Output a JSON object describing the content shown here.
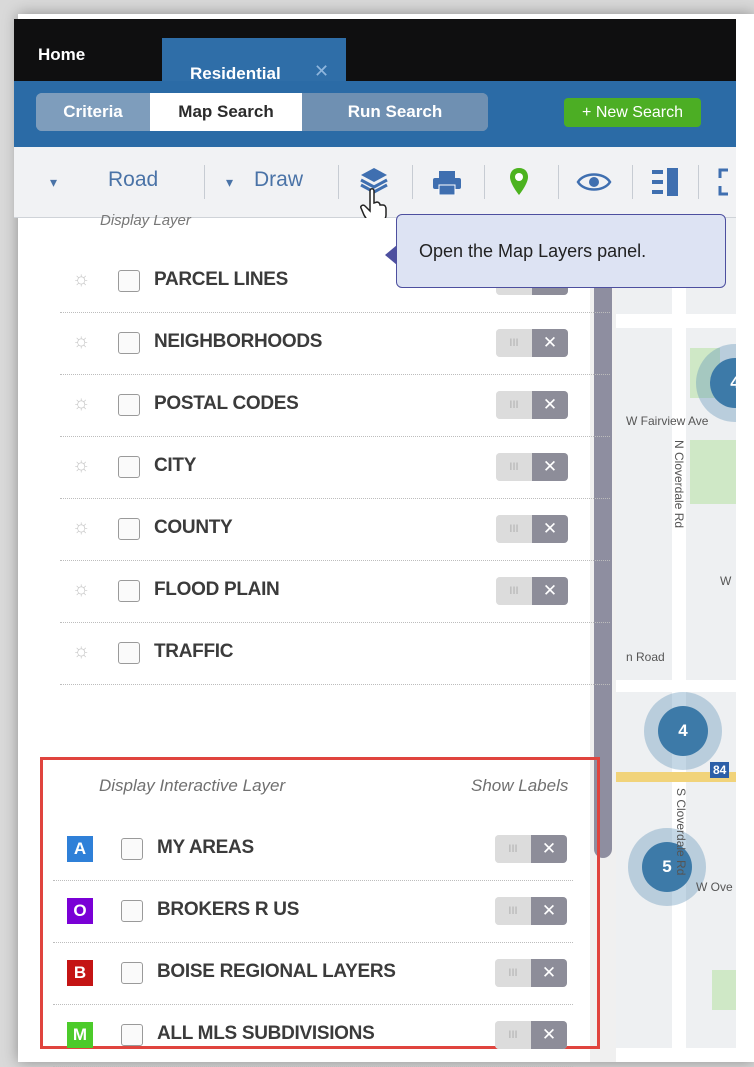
{
  "tabs": {
    "home": "Home",
    "residential": "Residential",
    "close": "✕"
  },
  "subnav": {
    "criteria": "Criteria",
    "map_search": "Map Search",
    "run_search": "Run Search",
    "new_search": "+ New Search"
  },
  "toolbar": {
    "road": "Road",
    "draw": "Draw"
  },
  "tooltip": "Open the Map Layers panel.",
  "panel": {
    "display_layer_header": "Display Layer",
    "layers": [
      "PARCEL LINES",
      "NEIGHBORHOODS",
      "POSTAL CODES",
      "CITY",
      "COUNTY",
      "FLOOD PLAIN",
      "TRAFFIC"
    ],
    "interactive_header": "Display Interactive Layer",
    "show_labels": "Show Labels",
    "interactive_layers": [
      {
        "badge": "A",
        "color": "#2f80d8",
        "name": "MY AREAS"
      },
      {
        "badge": "O",
        "color": "#7a00d6",
        "name": "BROKERS R US"
      },
      {
        "badge": "B",
        "color": "#c41414",
        "name": "BOISE REGIONAL LAYERS"
      },
      {
        "badge": "M",
        "color": "#4ccb2a",
        "name": "ALL MLS SUBDIVISIONS"
      }
    ]
  },
  "map": {
    "clusters": [
      "4",
      "4",
      "5"
    ],
    "labels": [
      "W Fairview Ave",
      "N Cloverdale Rd",
      "W",
      "n Road",
      "84",
      "S Cloverdale Rd",
      "W Ove"
    ]
  }
}
